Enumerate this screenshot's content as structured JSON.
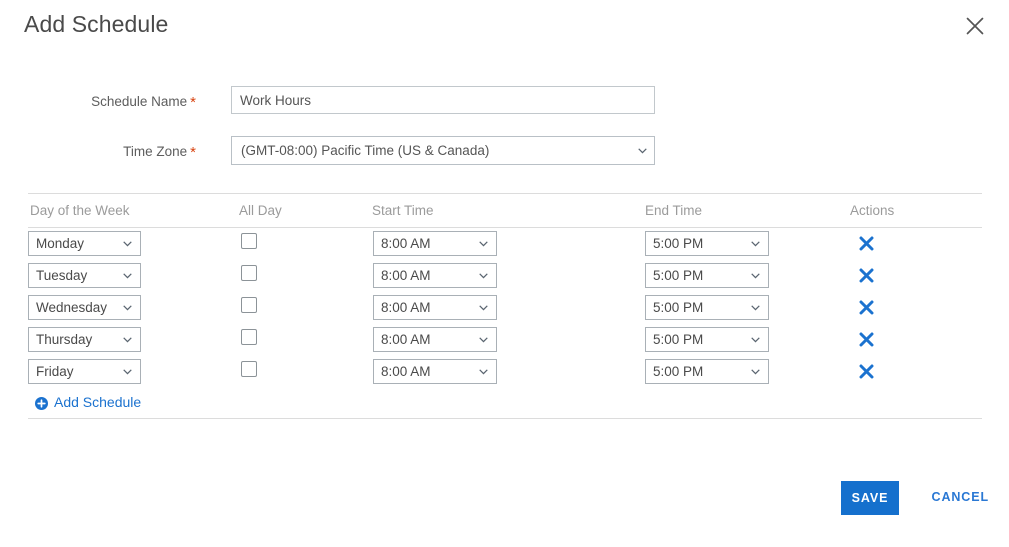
{
  "dialog": {
    "title": "Add Schedule",
    "close_icon": "close-icon"
  },
  "form": {
    "schedule_name": {
      "label": "Schedule Name",
      "required_marker": "*",
      "value": "Work Hours",
      "placeholder": ""
    },
    "time_zone": {
      "label": "Time Zone",
      "required_marker": "*",
      "value": "(GMT-08:00) Pacific Time (US & Canada)"
    }
  },
  "table": {
    "headers": {
      "day": "Day of the Week",
      "all_day": "All Day",
      "start_time": "Start Time",
      "end_time": "End Time",
      "actions": "Actions"
    },
    "rows": [
      {
        "day": "Monday",
        "all_day": false,
        "start_time": "8:00 AM",
        "end_time": "5:00 PM",
        "delete_icon": "delete-x-icon"
      },
      {
        "day": "Tuesday",
        "all_day": false,
        "start_time": "8:00 AM",
        "end_time": "5:00 PM",
        "delete_icon": "delete-x-icon"
      },
      {
        "day": "Wednesday",
        "all_day": false,
        "start_time": "8:00 AM",
        "end_time": "5:00 PM",
        "delete_icon": "delete-x-icon"
      },
      {
        "day": "Thursday",
        "all_day": false,
        "start_time": "8:00 AM",
        "end_time": "5:00 PM",
        "delete_icon": "delete-x-icon"
      },
      {
        "day": "Friday",
        "all_day": false,
        "start_time": "8:00 AM",
        "end_time": "5:00 PM",
        "delete_icon": "delete-x-icon"
      }
    ],
    "add_link": {
      "label": "Add Schedule",
      "icon": "plus-circle-icon"
    }
  },
  "footer": {
    "save_label": "SAVE",
    "cancel_label": "CANCEL"
  },
  "colors": {
    "accent_blue": "#1570cd",
    "link_blue": "#2a78d4",
    "required_red": "#d8430f",
    "border_gray": "#b9c0c6",
    "header_text": "#9b9b9b"
  }
}
